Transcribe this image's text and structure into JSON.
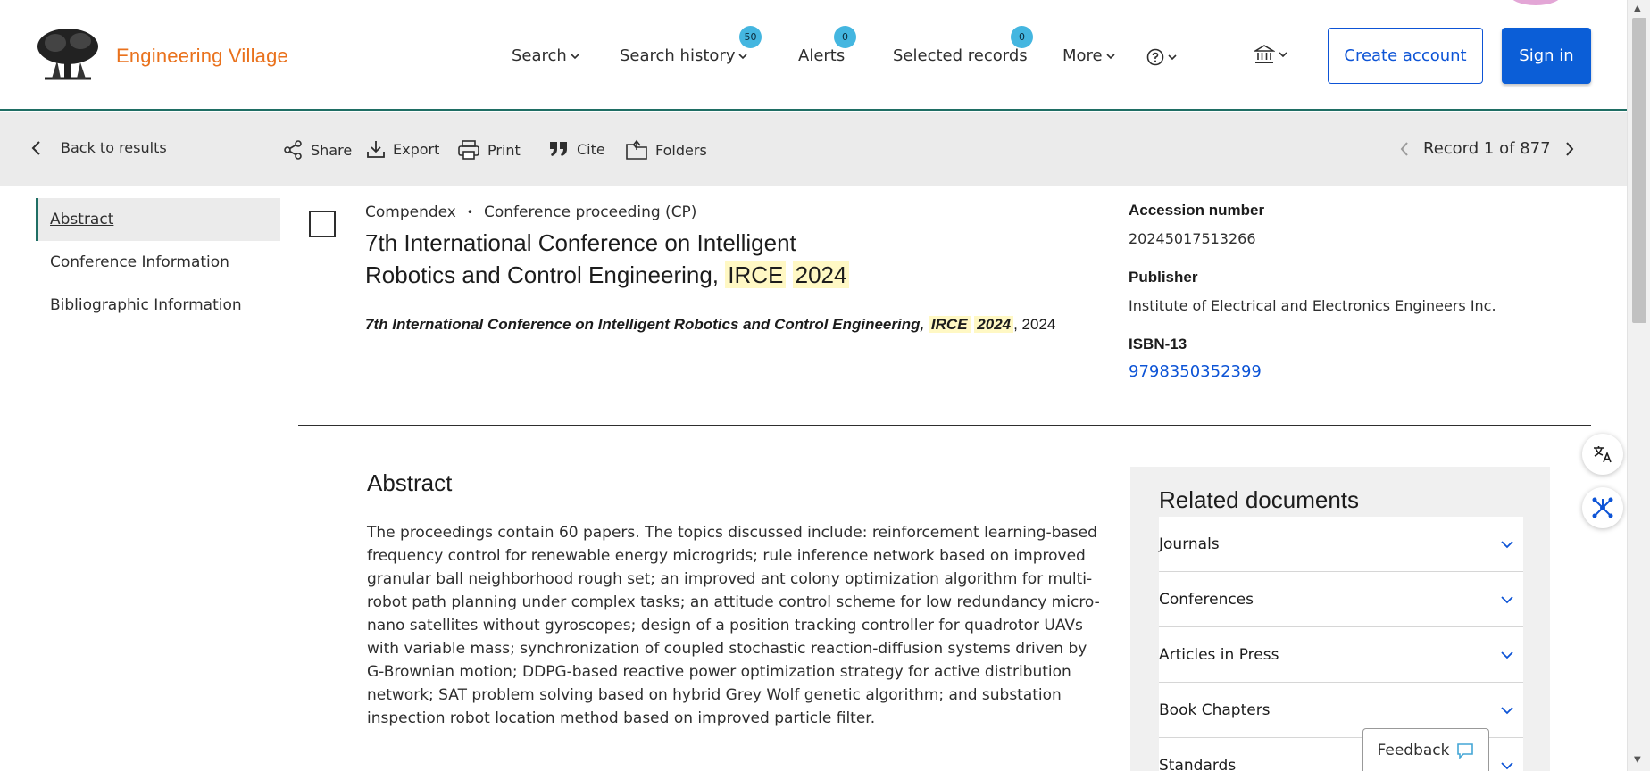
{
  "header": {
    "brand": "Engineering Village",
    "nav": {
      "search": "Search",
      "search_history": "Search history",
      "search_history_count": "50",
      "alerts": "Alerts",
      "alerts_count": "0",
      "selected_records": "Selected records",
      "selected_records_count": "0",
      "more": "More"
    },
    "create_account": "Create account",
    "sign_in": "Sign in"
  },
  "toolbar": {
    "back": "Back to results",
    "share": "Share",
    "export": "Export",
    "print": "Print",
    "cite": "Cite",
    "folders": "Folders",
    "record_position": "Record 1 of 877"
  },
  "sidebar": {
    "items": [
      {
        "label": "Abstract"
      },
      {
        "label": "Conference Information"
      },
      {
        "label": "Bibliographic Information"
      }
    ]
  },
  "record": {
    "database": "Compendex",
    "separator": "•",
    "doc_type": "Conference proceeding (CP)",
    "title_prefix": "7th International Conference on Intelligent Robotics and Control Engineering, ",
    "title_hl1": "IRCE",
    "title_hl2": "2024",
    "source_prefix": "7th International Conference on Intelligent Robotics and Control Engineering, ",
    "source_hl1": "IRCE",
    "source_hl2": "2024",
    "source_year": ", 2024",
    "accession_label": "Accession number",
    "accession_value": "20245017513266",
    "publisher_label": "Publisher",
    "publisher_value": "Institute of Electrical and Electronics Engineers Inc.",
    "isbn_label": "ISBN-13",
    "isbn_value": "9798350352399"
  },
  "abstract": {
    "heading": "Abstract",
    "text": "The proceedings contain 60 papers. The topics discussed include: reinforcement learning-based frequency control for renewable energy microgrids; rule inference network based on improved granular ball neighborhood rough set; an improved ant colony optimization algorithm for multi-robot path planning under complex tasks; an attitude control scheme for low redundancy micro-nano satellites without gyroscopes; design of a position tracking controller for quadrotor UAVs with variable mass; synchronization of coupled stochastic reaction-diffusion systems driven by G-Brownian motion; DDPG-based reactive power optimization strategy for active distribution network; SAT problem solving based on hybrid Grey Wolf genetic algorithm; and substation inspection robot location method based on improved particle filter."
  },
  "related": {
    "heading": "Related documents",
    "items": [
      {
        "label": "Journals"
      },
      {
        "label": "Conferences"
      },
      {
        "label": "Articles in Press"
      },
      {
        "label": "Book Chapters"
      },
      {
        "label": "Standards"
      }
    ]
  },
  "feedback": "Feedback",
  "colors": {
    "brand_orange": "#e9711c",
    "primary_blue": "#0b5ed7",
    "accent_teal": "#1f6e64",
    "badge_blue": "#44b6e0",
    "highlight_yellow": "#fff8c4"
  },
  "icons": [
    "tree-logo-icon",
    "chevron-down-icon",
    "help-icon",
    "institution-icon",
    "chevron-left-icon",
    "share-icon",
    "export-icon",
    "print-icon",
    "cite-icon",
    "folder-icon",
    "chevron-right-icon",
    "translate-icon",
    "network-icon",
    "chat-icon"
  ]
}
